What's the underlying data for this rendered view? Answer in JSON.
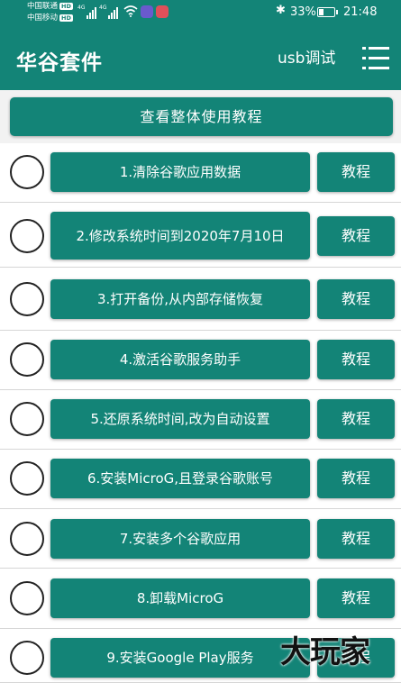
{
  "status_bar": {
    "carrier1": "中国联通",
    "carrier2": "中国移动",
    "hd_badge": "HD",
    "network": "4G",
    "battery_percent": "33%",
    "battery_level": 0.33,
    "time": "21:48"
  },
  "app_bar": {
    "title": "华谷套件",
    "usb_button": "usb调试",
    "menu_icon": "menu-icon"
  },
  "overview_button": "查看整体使用教程",
  "tutorial_label": "教程",
  "steps": [
    {
      "label": "1.清除谷歌应用数据"
    },
    {
      "label": "2.修改系统时间到2020年7月10日"
    },
    {
      "label": "3.打开备份,从内部存储恢复"
    },
    {
      "label": "4.激活谷歌服务助手"
    },
    {
      "label": "5.还原系统时间,改为自动设置"
    },
    {
      "label": "6.安装MicroG,且登录谷歌账号"
    },
    {
      "label": "7.安装多个谷歌应用"
    },
    {
      "label": "8.卸载MicroG"
    },
    {
      "label": "9.安装Google Play服务"
    }
  ],
  "watermark": "大玩家",
  "colors": {
    "primary": "#138477",
    "background": "#f2f2f2",
    "row_background": "#ffffff"
  }
}
